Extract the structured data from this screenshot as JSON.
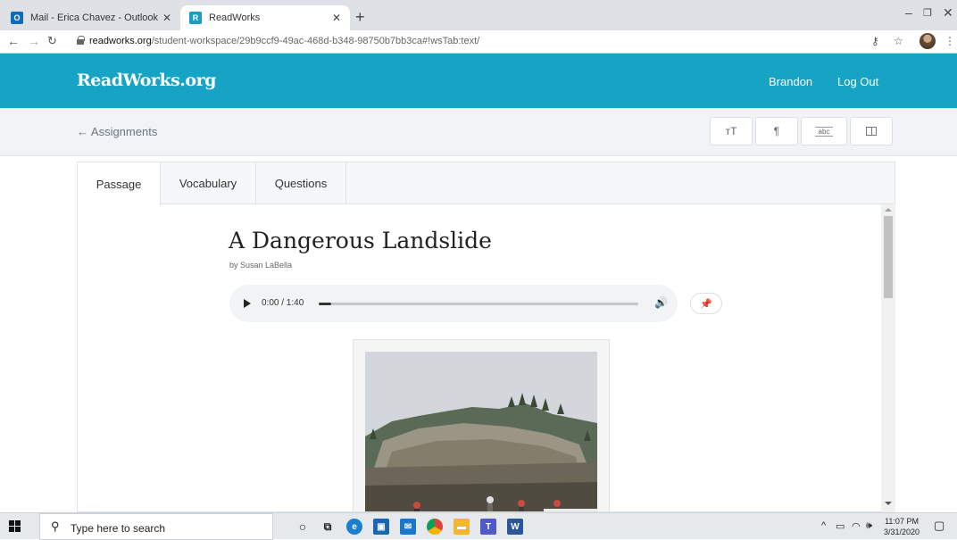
{
  "browser": {
    "tabs": [
      {
        "title": "Mail - Erica Chavez - Outlook",
        "icon": "outlook-icon",
        "color": "#0f6cbd"
      },
      {
        "title": "ReadWorks",
        "icon": "readworks-icon",
        "color": "#1a9dc4"
      }
    ],
    "url_host": "readworks.org",
    "url_path": "/student-workspace/29b9ccf9-49ac-468d-b348-98750b7bb3ca#!wsTab:text/"
  },
  "header": {
    "logo": "ReadWorks.org",
    "user": "Brandon",
    "logout": "Log Out",
    "color": "#16a3c4"
  },
  "subbar": {
    "back_label": "← Assignments",
    "tools": [
      "text-size-icon",
      "paragraph-icon",
      "highlight-icon",
      "columns-icon"
    ]
  },
  "content": {
    "tabs": [
      "Passage",
      "Vocabulary",
      "Questions"
    ],
    "active_tab": "Passage",
    "title": "A Dangerous Landslide",
    "byline": "by Susan LaBella",
    "audio": {
      "time": "0:00 / 1:40",
      "progress": 0.04
    }
  },
  "taskbar": {
    "search_placeholder": "Type here to search",
    "time": "11:07 PM",
    "date": "3/31/2020"
  }
}
